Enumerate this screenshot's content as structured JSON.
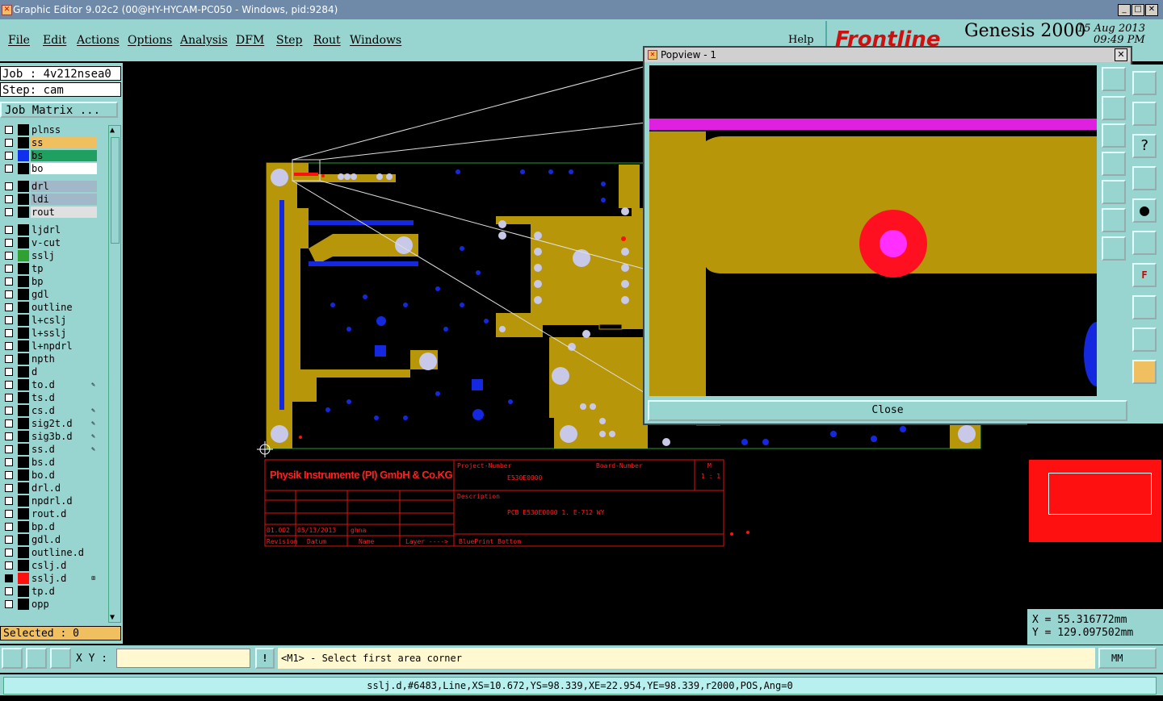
{
  "window": {
    "title": "Graphic Editor 9.02c2 (00@HY-HYCAM-PC050 - Windows, pid:9284)"
  },
  "menu": [
    "File",
    "Edit",
    "Actions",
    "Options",
    "Analysis",
    "DFM",
    "Step",
    "Rout",
    "Windows"
  ],
  "help_label": "Help",
  "brand": {
    "frontline": "Frontline",
    "product": "Genesis 2000",
    "date": "15 Aug 2013",
    "time": "09:49 PM"
  },
  "job": {
    "job_label": "Job : 4v212nsea0",
    "step_label": "Step: cam",
    "matrix_button": "Job Matrix ..."
  },
  "layers": [
    {
      "name": "plnss",
      "color": "#000000",
      "bg": "#98d4d0"
    },
    {
      "name": "ss",
      "color": "#000000",
      "bg": "#f0c060"
    },
    {
      "name": "bs",
      "color": "#1030f0",
      "bg": "#20a060"
    },
    {
      "name": "bo",
      "color": "#000000",
      "bg": "#ffffff"
    },
    {
      "name": "drl",
      "color": "#000000",
      "bg": "#a0b8c8"
    },
    {
      "name": "ldi",
      "color": "#000000",
      "bg": "#a0b8c8"
    },
    {
      "name": "rout",
      "color": "#000000",
      "bg": "#e0e0e0"
    },
    {
      "name": "ljdrl",
      "color": "#000000",
      "bg": "#98d4d0"
    },
    {
      "name": "v-cut",
      "color": "#000000",
      "bg": "#98d4d0"
    },
    {
      "name": "sslj",
      "color": "#30a030",
      "bg": "#98d4d0"
    },
    {
      "name": "tp",
      "color": "#000000",
      "bg": "#98d4d0"
    },
    {
      "name": "bp",
      "color": "#000000",
      "bg": "#98d4d0"
    },
    {
      "name": "gdl",
      "color": "#000000",
      "bg": "#98d4d0"
    },
    {
      "name": "outline",
      "color": "#000000",
      "bg": "#98d4d0"
    },
    {
      "name": "l+cslj",
      "color": "#000000",
      "bg": "#98d4d0"
    },
    {
      "name": "l+sslj",
      "color": "#000000",
      "bg": "#98d4d0"
    },
    {
      "name": "l+npdrl",
      "color": "#000000",
      "bg": "#98d4d0"
    },
    {
      "name": "npth",
      "color": "#000000",
      "bg": "#98d4d0"
    },
    {
      "name": "d",
      "color": "#000000",
      "bg": "#98d4d0"
    },
    {
      "name": "to.d",
      "color": "#000000",
      "bg": "#98d4d0",
      "mark": "✎"
    },
    {
      "name": "ts.d",
      "color": "#000000",
      "bg": "#98d4d0"
    },
    {
      "name": "cs.d",
      "color": "#000000",
      "bg": "#98d4d0",
      "mark": "✎"
    },
    {
      "name": "sig2t.d",
      "color": "#000000",
      "bg": "#98d4d0",
      "mark": "✎"
    },
    {
      "name": "sig3b.d",
      "color": "#000000",
      "bg": "#98d4d0",
      "mark": "✎"
    },
    {
      "name": "ss.d",
      "color": "#000000",
      "bg": "#98d4d0",
      "mark": "✎"
    },
    {
      "name": "bs.d",
      "color": "#000000",
      "bg": "#98d4d0"
    },
    {
      "name": "bo.d",
      "color": "#000000",
      "bg": "#98d4d0"
    },
    {
      "name": "drl.d",
      "color": "#000000",
      "bg": "#98d4d0"
    },
    {
      "name": "npdrl.d",
      "color": "#000000",
      "bg": "#98d4d0"
    },
    {
      "name": "rout.d",
      "color": "#000000",
      "bg": "#98d4d0"
    },
    {
      "name": "bp.d",
      "color": "#000000",
      "bg": "#98d4d0"
    },
    {
      "name": "gdl.d",
      "color": "#000000",
      "bg": "#98d4d0"
    },
    {
      "name": "outline.d",
      "color": "#000000",
      "bg": "#98d4d0"
    },
    {
      "name": "cslj.d",
      "color": "#000000",
      "bg": "#98d4d0"
    },
    {
      "name": "sslj.d",
      "color": "#ff1010",
      "bg": "#98d4d0",
      "mark": "⊞",
      "checked": true
    },
    {
      "name": "tp.d",
      "color": "#000000",
      "bg": "#98d4d0"
    },
    {
      "name": "opp",
      "color": "#000000",
      "bg": "#98d4d0"
    }
  ],
  "selected_label": "Selected : 0",
  "titleblock": {
    "company": "Physik Instrumente (PI) GmbH & Co.KG",
    "project_number_label": "Project-Number",
    "project_number": "E530E0000",
    "board_number_label": "Board-Number",
    "scale_label": "M",
    "scale": "1 : 1",
    "description_label": "Description",
    "description": "PCB E530E0000 1. E-712 WY",
    "revision": "01.002",
    "date": "05/13/2013",
    "name": "ghna",
    "revision_label": "Revision",
    "date_label": "Datum",
    "name_label": "Name",
    "layer_label": "Layer ---->",
    "layer_value": "BluePrint Bottom"
  },
  "popview": {
    "title": "Popview - 1",
    "close_label": "Close"
  },
  "coords": {
    "x": "X  =  55.316772mm",
    "y": "Y  =  129.097502mm"
  },
  "cmd": {
    "xy_label": "X Y :",
    "xy_value": "",
    "prompt": "<M1> - Select first area corner",
    "units": "MM"
  },
  "status": "sslj.d,#6483,Line,XS=10.672,YS=98.339,XE=22.954,YE=98.339,r2000,POS,Ang=0",
  "colors": {
    "panel": "#98d4d0",
    "copper": "#b8960a",
    "pad": "#1428e0",
    "drill": "#c8c8e8",
    "highlight": "#ff1010",
    "magenta": "#ff20ff"
  }
}
